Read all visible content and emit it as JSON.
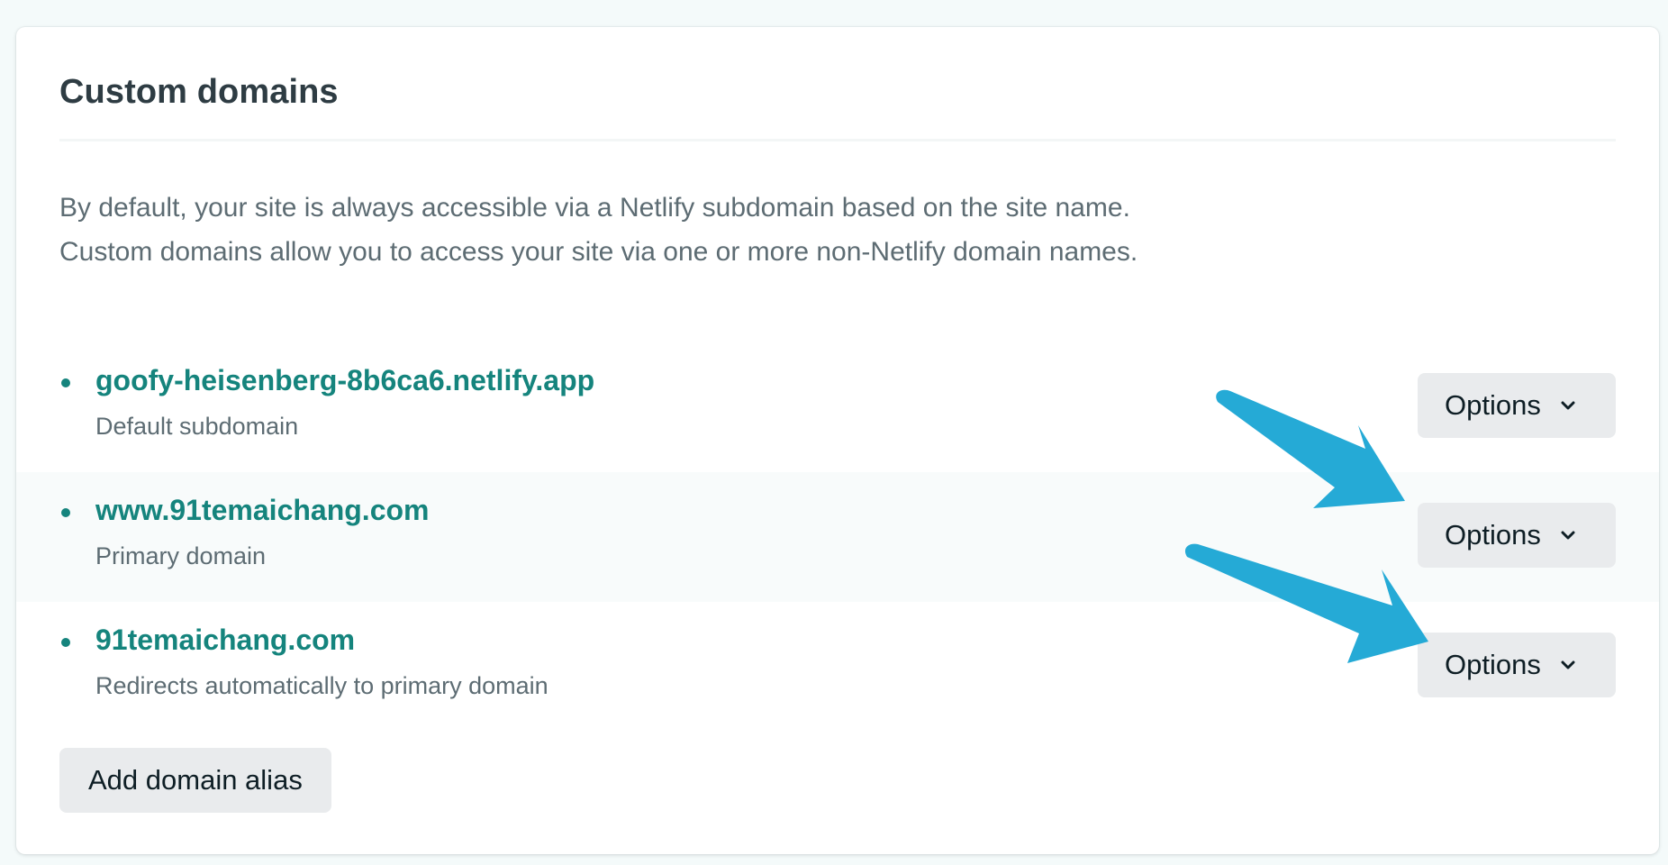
{
  "section": {
    "title": "Custom domains",
    "description_line1": "By default, your site is always accessible via a Netlify subdomain based on the site name.",
    "description_line2": "Custom domains allow you to access your site via one or more non-Netlify domain names."
  },
  "domains": [
    {
      "name": "goofy-heisenberg-8b6ca6.netlify.app",
      "subtitle": "Default subdomain",
      "options_label": "Options",
      "highlighted": false
    },
    {
      "name": "www.91temaichang.com",
      "subtitle": "Primary domain",
      "options_label": "Options",
      "highlighted": true
    },
    {
      "name": "91temaichang.com",
      "subtitle": "Redirects automatically to primary domain",
      "options_label": "Options",
      "highlighted": false
    }
  ],
  "add_button_label": "Add domain alias",
  "colors": {
    "page_background": "#f4fafa",
    "card_background": "#ffffff",
    "title_text": "#2e3c43",
    "body_text": "#5d6c73",
    "link_teal": "#15847d",
    "button_background": "#e9ebed",
    "button_text": "#0e1e25",
    "highlight_row": "#f8fbfb",
    "annotation_arrow": "#25aad6"
  },
  "icons": {
    "options_chevron": "chevron-down-icon",
    "list_bullet": "bullet-dot-icon",
    "annotation": "arrow-annotation-icon"
  }
}
